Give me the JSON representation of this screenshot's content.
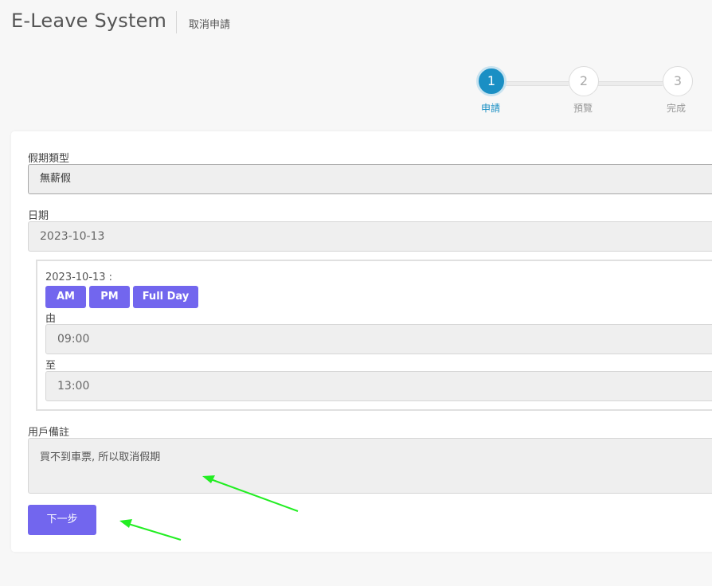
{
  "header": {
    "app_title": "E-Leave System",
    "page_subtitle": "取消申請"
  },
  "stepper": {
    "steps": [
      {
        "number": "1",
        "label": "申請",
        "active": true
      },
      {
        "number": "2",
        "label": "預覽",
        "active": false
      },
      {
        "number": "3",
        "label": "完成",
        "active": false
      }
    ],
    "active_color": "#1a8fc4"
  },
  "form": {
    "leave_type_label": "假期類型",
    "leave_type_value": "無薪假",
    "date_label": "日期",
    "date_value": "2023-10-13",
    "slot": {
      "date_text": "2023-10-13 :",
      "am_label": "AM",
      "pm_label": "PM",
      "full_day_label": "Full Day",
      "from_label": "由",
      "from_value": "09:00",
      "to_label": "至",
      "to_value": "13:00"
    },
    "remark_label": "用戶備註",
    "remark_value": "買不到車票, 所以取消假期",
    "next_label": "下一步"
  },
  "annotations": {
    "arrow_color": "#22ee22"
  },
  "colors": {
    "primary_button": "#7266ee",
    "background": "#f7f7f7"
  }
}
